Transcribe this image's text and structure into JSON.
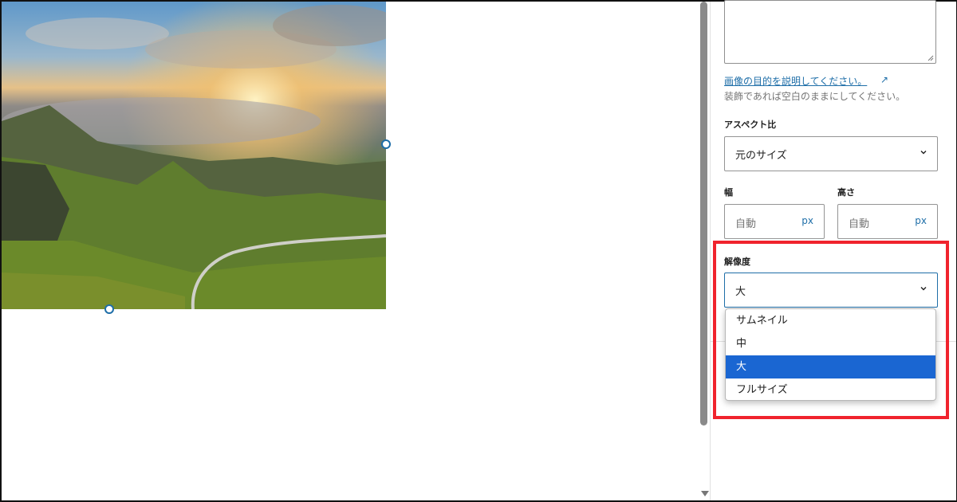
{
  "sidebar": {
    "alt_link": "画像の目的を説明してください。",
    "alt_help": "装飾であれば空白のままにしてください。",
    "aspect_ratio": {
      "label": "アスペクト比",
      "value": "元のサイズ"
    },
    "width": {
      "label": "幅",
      "placeholder": "自動",
      "unit": "px"
    },
    "height": {
      "label": "高さ",
      "placeholder": "自動",
      "unit": "px"
    },
    "resolution": {
      "label": "解像度",
      "value": "大",
      "options": [
        "サムネイル",
        "中",
        "大",
        "フルサイズ"
      ],
      "selected_index": 2
    }
  },
  "icons": {
    "external": "↗",
    "chevron": "chevron-down-icon"
  },
  "colors": {
    "accent": "#1e6ea8",
    "selected_option": "#1a66d2",
    "highlight": "#f0232d"
  }
}
